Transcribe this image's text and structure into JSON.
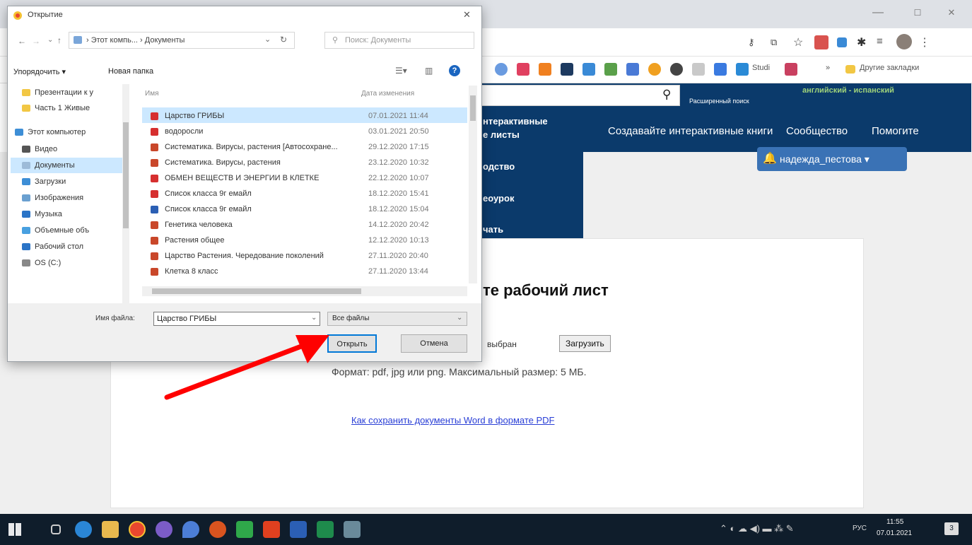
{
  "window_controls": {
    "minimize": "—",
    "maximize": "☐",
    "close": "✕"
  },
  "bookmarks": {
    "studi": "Studi",
    "more": "»",
    "other": "Другие закладки"
  },
  "site": {
    "search_placeholder": "",
    "advanced_search": "Расширенный поиск",
    "lang": "английский - испанский",
    "menu_items": [
      "Интерактивные рабочие листы",
      "Руководство",
      "Видеоурок",
      "Начать"
    ],
    "menu_visible": [
      "нтерактивные",
      "е листы",
      "одство",
      "еоурок",
      "чать"
    ],
    "nav": [
      "Создавайте интерактивные книги",
      "Сообщество",
      "Помогите"
    ],
    "user": "надежда_пестова ▾",
    "heading": "те рабочий лист",
    "file_status": "выбран",
    "upload_btn": "Загрузить",
    "format_note": "Формат: pdf, jpg или png. Максимальный размер: 5 МБ.",
    "help_link": "Как сохранить документы Word в формате PDF"
  },
  "dialog": {
    "title": "Открытие",
    "close": "✕",
    "breadcrumb": "› Этот компь... › Документы",
    "search_placeholder": "Поиск: Документы",
    "organize": "Упорядочить ▾",
    "new_folder": "Новая папка",
    "col_name": "Имя",
    "col_date": "Дата изменения",
    "nav_items": [
      "Презентации к у",
      "Часть 1 Живые",
      "Этот компьютер",
      "Видео",
      "Документы",
      "Загрузки",
      "Изображения",
      "Музыка",
      "Объемные объ",
      "Рабочий стол",
      "OS (C:)"
    ],
    "files": [
      {
        "name": "Царство ГРИБЫ",
        "date": "07.01.2021 11:44",
        "type": "pdf"
      },
      {
        "name": "водоросли",
        "date": "03.01.2021 20:50",
        "type": "pdf"
      },
      {
        "name": "Систематика. Вирусы, растения [Автосохране...",
        "date": "29.12.2020 17:15",
        "type": "ppt"
      },
      {
        "name": "Систематика. Вирусы, растения",
        "date": "23.12.2020 10:32",
        "type": "ppt"
      },
      {
        "name": "ОБМЕН  ВЕЩЕСТВ  И ЭНЕРГИИ В  КЛЕТКЕ",
        "date": "22.12.2020 10:07",
        "type": "pdf"
      },
      {
        "name": "Список класса 9г емайл",
        "date": "18.12.2020 15:41",
        "type": "pdf"
      },
      {
        "name": "Список класса 9г емайл",
        "date": "18.12.2020 15:04",
        "type": "doc"
      },
      {
        "name": "Генетика человека",
        "date": "14.12.2020 20:42",
        "type": "ppt"
      },
      {
        "name": "Растения общее",
        "date": "12.12.2020 10:13",
        "type": "ppt"
      },
      {
        "name": "Царство Растения. Чередование поколений",
        "date": "27.11.2020 20:40",
        "type": "ppt"
      },
      {
        "name": "Клетка 8 класс",
        "date": "27.11.2020 13:44",
        "type": "ppt"
      }
    ],
    "filename_label": "Имя файла:",
    "filename_value": "Царство ГРИБЫ",
    "filter": "Все файлы",
    "open_btn": "Открыть",
    "cancel_btn": "Отмена"
  },
  "taskbar": {
    "lang": "РУС",
    "time": "11:55",
    "date": "07.01.2021",
    "notif": "3"
  },
  "colors": {
    "site_blue": "#0b3a6b",
    "user_blue": "#3a72b5",
    "arrow": "#ff0000",
    "selected": "#cce4f7"
  }
}
